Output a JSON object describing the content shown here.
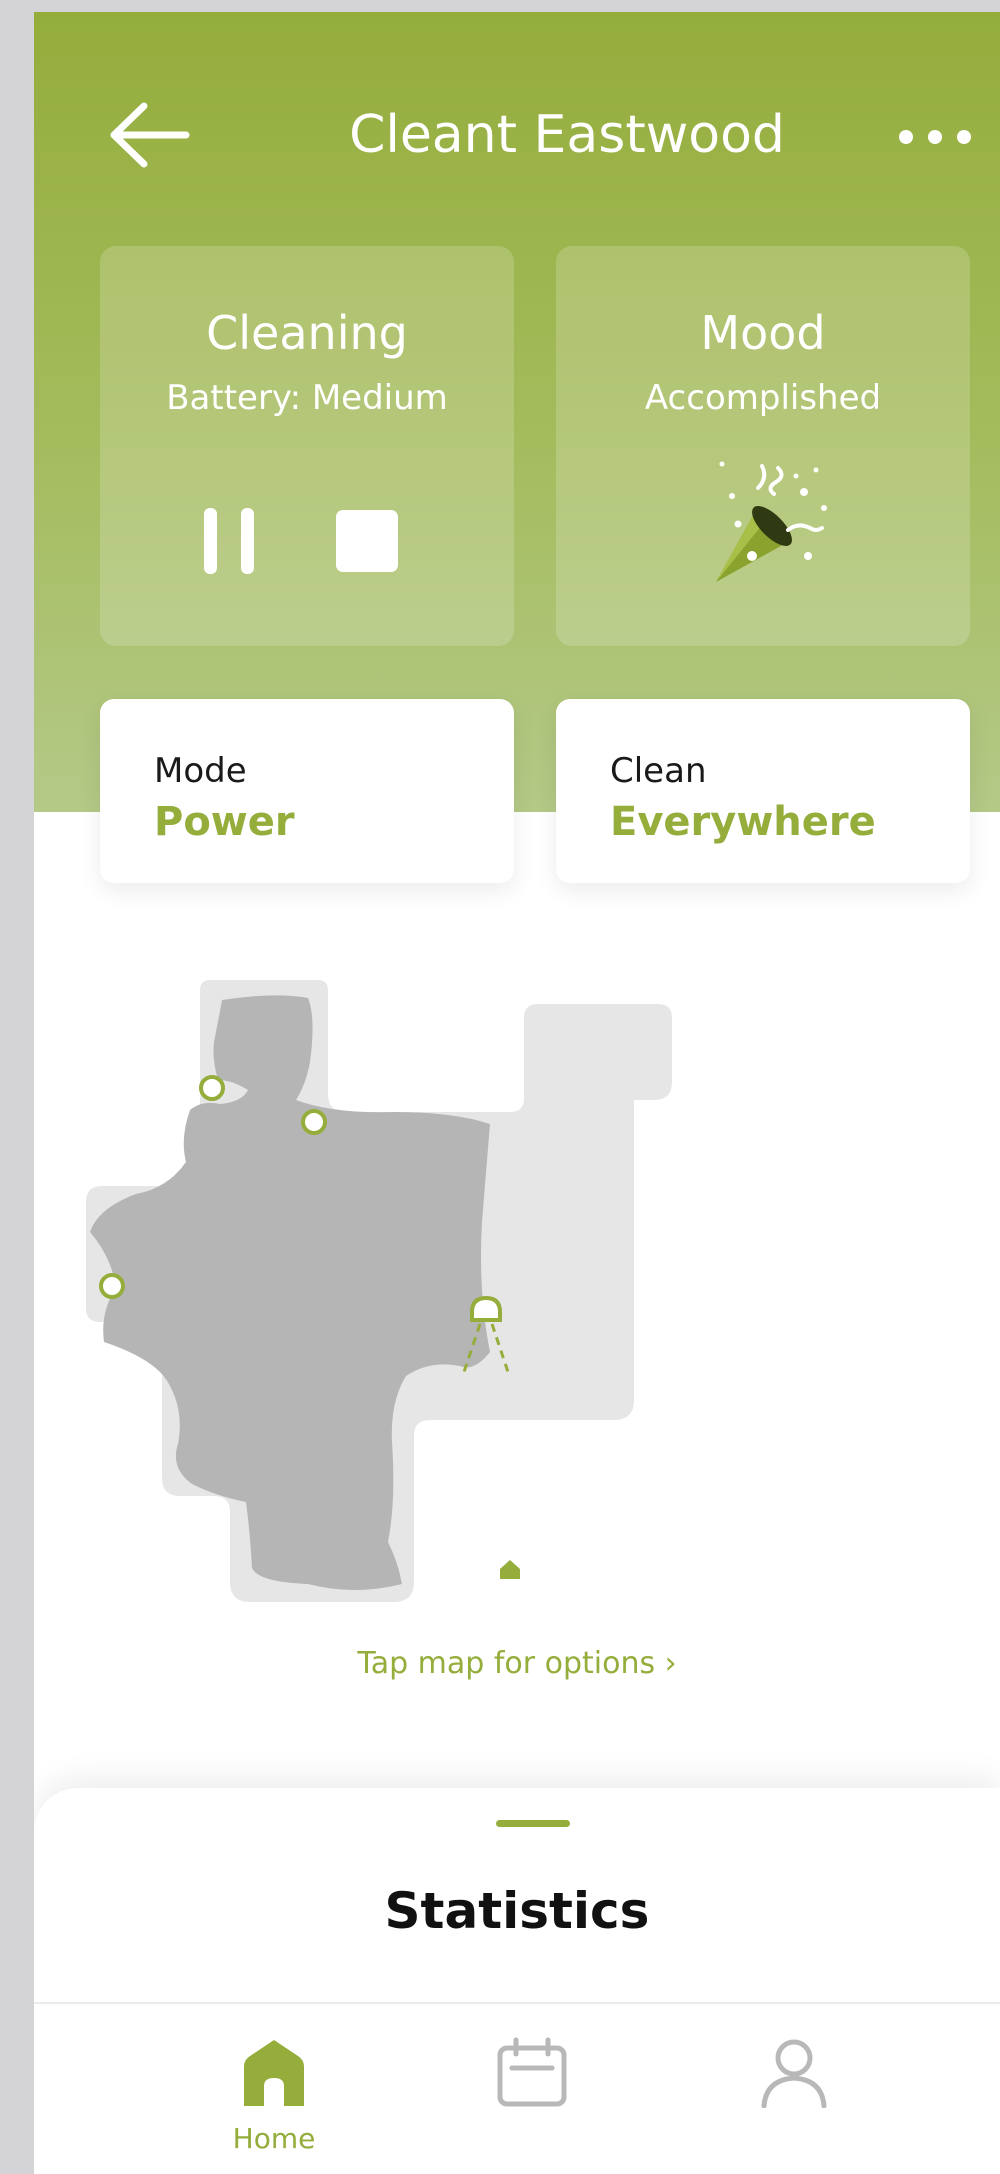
{
  "header": {
    "title": "Cleant Eastwood"
  },
  "status_card": {
    "title": "Cleaning",
    "subtitle": "Battery: Medium"
  },
  "mood_card": {
    "title": "Mood",
    "subtitle": "Accomplished"
  },
  "mode_card": {
    "label": "Mode",
    "value": "Power"
  },
  "clean_card": {
    "label": "Clean",
    "value": "Everywhere"
  },
  "map": {
    "hint": "Tap map for options ›"
  },
  "sheet": {
    "title": "Statistics"
  },
  "tabs": [
    {
      "label": "Home",
      "icon": "home-icon",
      "active": true
    },
    {
      "label": "",
      "icon": "calendar-icon",
      "active": false
    },
    {
      "label": "",
      "icon": "profile-icon",
      "active": false
    }
  ],
  "colors": {
    "accent": "#94ad3b",
    "header_top": "#94ad3b",
    "header_bottom": "#b4c987",
    "map_area": "#e6e6e6",
    "map_cleaned": "#b5b5b5"
  },
  "icons": [
    "back-arrow-icon",
    "more-icon",
    "pause-icon",
    "stop-icon",
    "party-popper-icon",
    "home-icon",
    "calendar-icon",
    "profile-icon",
    "chevron-right-icon"
  ]
}
